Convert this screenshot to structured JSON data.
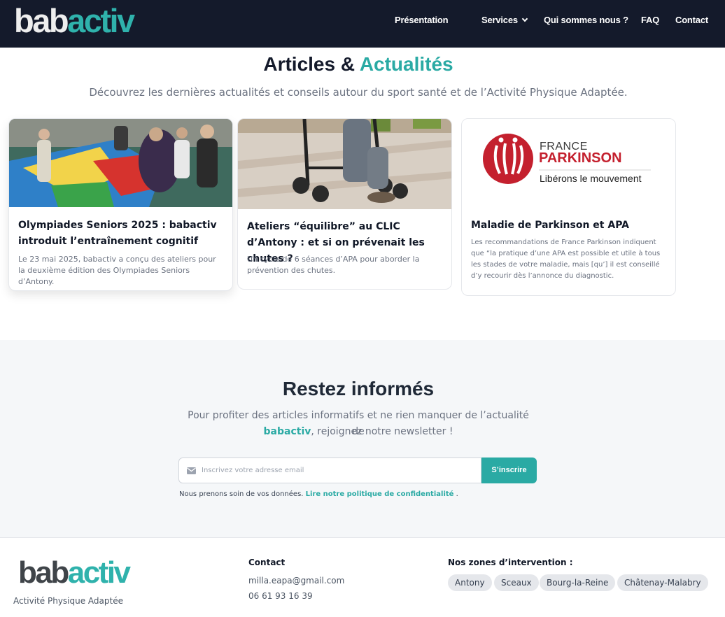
{
  "nav": {
    "logo_part1": "bab",
    "logo_part2": "activ",
    "items": [
      "Présentation",
      "Services",
      "Qui sommes nous ?",
      "FAQ",
      "Contact"
    ]
  },
  "articles": {
    "title_part1": "Articles & ",
    "title_part2": "Actualités",
    "subtitle": "Découvrez les dernières actualités et conseils autour du sport santé et de l’Activité Physique Adaptée.",
    "cards": [
      {
        "title": "Olympiades Seniors 2025 : babactiv introduit l’entraînement cognitif",
        "description": "Le 23 mai 2025, babactiv a conçu des ateliers pour la deuxième édition des Olympiades Seniors d’Antony."
      },
      {
        "title": "Ateliers “équilibre” au CLIC d’Antony : et si on prévenait les chutes ?",
        "description": "Un cycle de 6 séances d’APA pour aborder la prévention des chutes."
      },
      {
        "title": "Maladie de Parkinson et APA",
        "description": "Les recommandations de France Parkinson indiquent que “la pratique d’une APA est possible et utile à tous les stades de votre maladie, mais [qu’] il est conseillé d’y recourir dès l’annonce du diagnostic."
      }
    ],
    "parkinson_logo": {
      "line1": "FRANCE",
      "line2": "PARKINSON",
      "tagline": "Libérons le mouvement"
    }
  },
  "newsletter": {
    "title": "Restez informés",
    "text_part1": "Pour profiter des articles informatifs et ne rien manquer de l’actualité de",
    "brand": "babactiv",
    "text_part2": ", rejoignez notre newsletter !",
    "email_placeholder": "Inscrivez votre adresse email",
    "button_label": "S’inscrire",
    "privacy_text": "Nous prenons soin de vos données.",
    "privacy_link": "Lire notre politique de confidentialité",
    "privacy_end": "."
  },
  "footer": {
    "logo_part1": "bab",
    "logo_part2": "activ",
    "tagline": "Activité Physique Adaptée",
    "contact_heading": "Contact",
    "email": "milla.eapa@gmail.com",
    "phone": "06 61 93 16 39",
    "zones_heading": "Nos zones d’intervention :",
    "zones": [
      "Antony",
      "Sceaux",
      "Bourg-la-Reine",
      "Châtenay-Malabry"
    ]
  },
  "colors": {
    "nav_bg": "#141a2b",
    "accent": "#2aaaa4",
    "parkinson_red": "#c4202e"
  }
}
